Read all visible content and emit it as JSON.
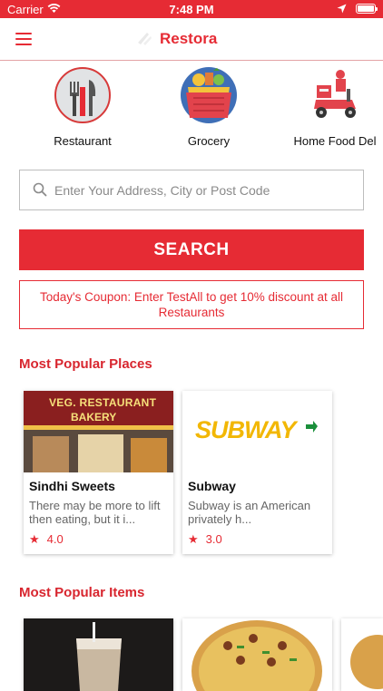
{
  "status_bar": {
    "carrier": "Carrier",
    "time": "7:48 PM"
  },
  "header": {
    "brand": "Restora"
  },
  "categories": [
    {
      "label": "Restaurant",
      "icon": "fork-knife-icon"
    },
    {
      "label": "Grocery",
      "icon": "grocery-basket-icon"
    },
    {
      "label": "Home Food Del",
      "icon": "delivery-scooter-icon"
    }
  ],
  "search": {
    "placeholder": "Enter Your Address, City or Post Code",
    "button_label": "SEARCH"
  },
  "coupon": {
    "text": "Today's Coupon: Enter TestAll to get 10% discount at all Restaurants"
  },
  "popular_places": {
    "title": "Most Popular Places",
    "items": [
      {
        "name": "Sindhi Sweets",
        "description": "There may be more to lift then eating, but it i...",
        "rating": "4.0",
        "sign_line1": "VEG. RESTAURANT",
        "sign_line2": "BAKERY"
      },
      {
        "name": "Subway",
        "description": "Subway is an American privately h...",
        "rating": "3.0",
        "logo_text": "SUBWAY"
      }
    ]
  },
  "popular_items": {
    "title": "Most Popular Items"
  },
  "colors": {
    "primary": "#e62b34",
    "subway_yellow": "#f2b705",
    "subway_green": "#1a8f3b"
  }
}
